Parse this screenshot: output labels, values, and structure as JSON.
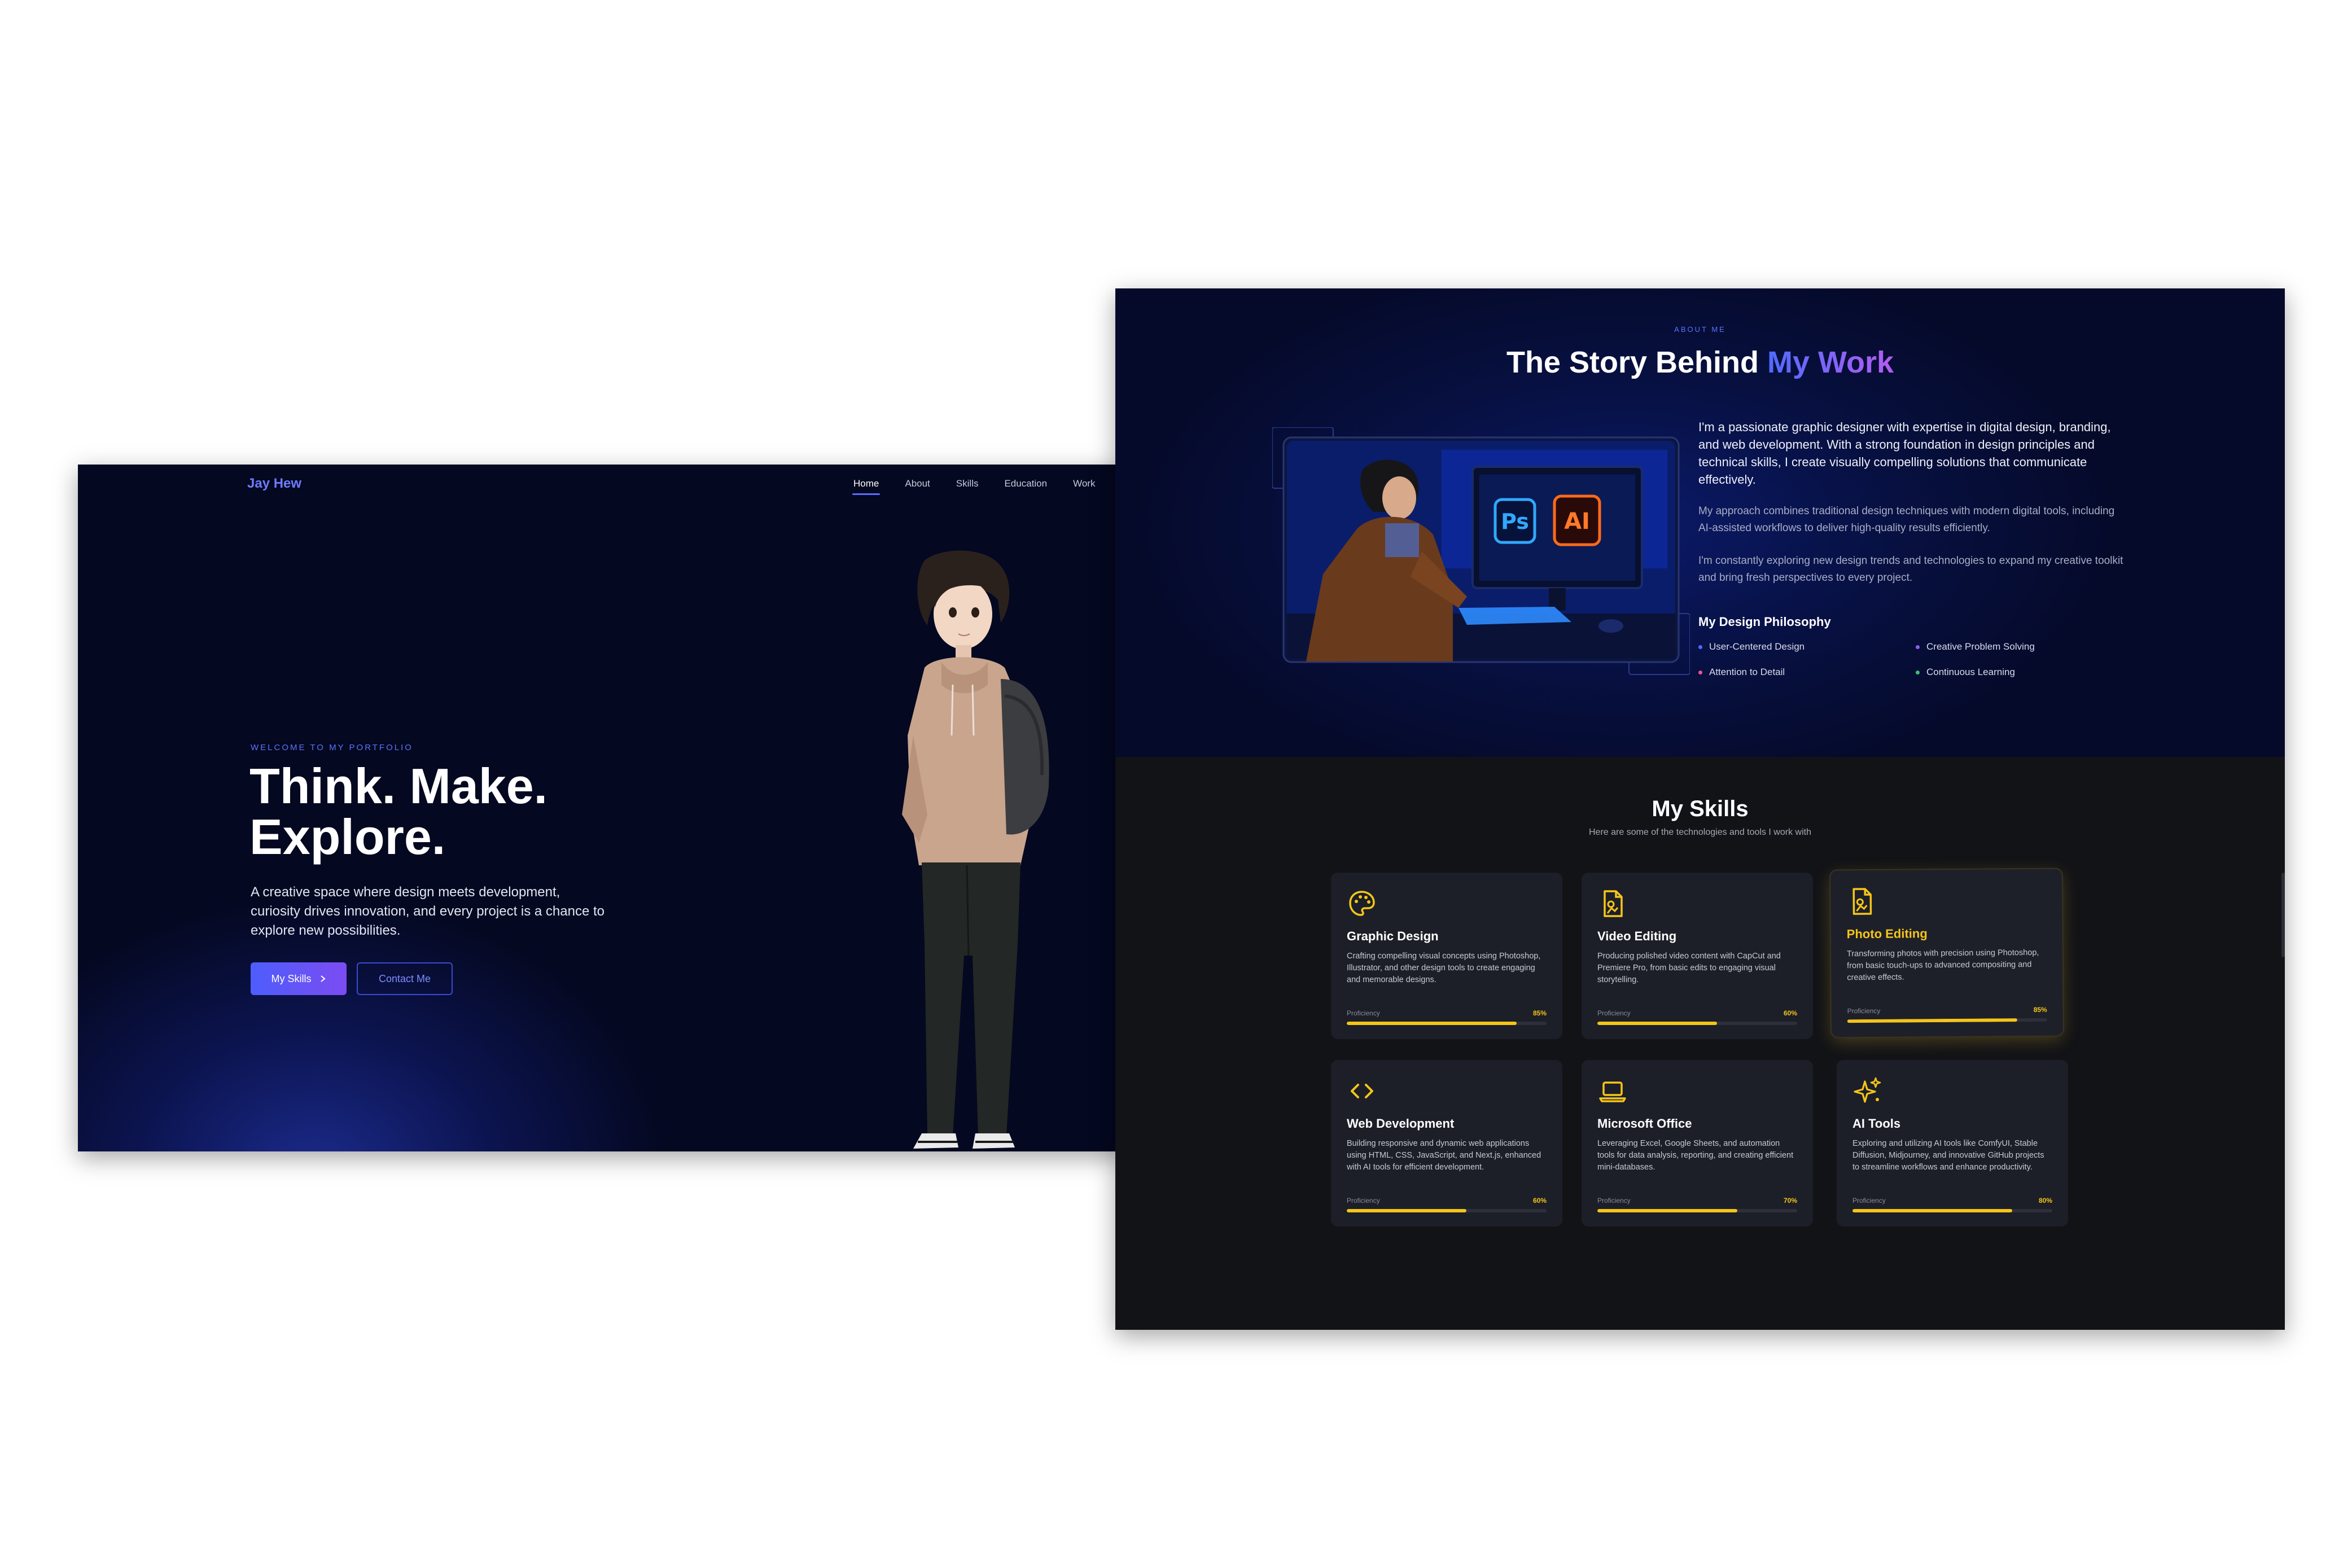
{
  "hero": {
    "logo": "Jay Hew",
    "nav": [
      "Home",
      "About",
      "Skills",
      "Education",
      "Work"
    ],
    "eyebrow": "WELCOME TO MY PORTFOLIO",
    "title_line1": "Think. Make.",
    "title_line2": "Explore.",
    "description": "A creative space where design meets development, curiosity drives innovation, and every project is a chance to explore new possibilities.",
    "primary_button": "My Skills",
    "primary_button_icon": "chevron-right-icon",
    "secondary_button": "Contact Me"
  },
  "about": {
    "eyebrow": "ABOUT ME",
    "title_plain": "The Story Behind ",
    "title_highlight": "My Work",
    "p1": "I'm a passionate graphic designer with expertise in digital design, branding, and web development. With a strong foundation in design principles and technical skills, I create visually compelling solutions that communicate effectively.",
    "p2": "My approach combines traditional design techniques with modern digital tools, including AI-assisted workflows to deliver high-quality results efficiently.",
    "p3": "I'm constantly exploring new design trends and technologies to expand my creative toolkit and bring fresh perspectives to every project.",
    "philosophy_title": "My Design Philosophy",
    "philosophy": [
      {
        "label": "User-Centered Design",
        "color": "#4f6bff"
      },
      {
        "label": "Creative Problem Solving",
        "color": "#8f5cf0"
      },
      {
        "label": "Attention to Detail",
        "color": "#e8558a"
      },
      {
        "label": "Continuous Learning",
        "color": "#39c07a"
      }
    ],
    "illustration_labels": [
      "Ps",
      "AI"
    ]
  },
  "skills": {
    "title": "My Skills",
    "subtitle": "Here are some of the technologies and tools I work with",
    "proficiency_label": "Proficiency",
    "accent": "#f5c518",
    "cards": [
      {
        "icon": "palette-icon",
        "title": "Graphic Design",
        "desc": "Crafting compelling visual concepts using Photoshop, Illustrator, and other design tools to create engaging and memorable designs.",
        "value": "85%",
        "pct": 85
      },
      {
        "icon": "video-file-icon",
        "title": "Video Editing",
        "desc": "Producing polished video content with CapCut and Premiere Pro, from basic edits to engaging visual storytelling.",
        "value": "60%",
        "pct": 60
      },
      {
        "icon": "image-file-icon",
        "title": "Photo Editing",
        "desc": "Transforming photos with precision using Photoshop, from basic touch-ups to advanced compositing and creative effects.",
        "value": "85%",
        "pct": 85
      },
      {
        "icon": "code-icon",
        "title": "Web Development",
        "desc": "Building responsive and dynamic web applications using HTML, CSS, JavaScript, and Next.js, enhanced with AI tools for efficient development.",
        "value": "60%",
        "pct": 60
      },
      {
        "icon": "laptop-icon",
        "title": "Microsoft Office",
        "desc": "Leveraging Excel, Google Sheets, and automation tools for data analysis, reporting, and creating efficient mini-databases.",
        "value": "70%",
        "pct": 70
      },
      {
        "icon": "sparkles-icon",
        "title": "AI Tools",
        "desc": "Exploring and utilizing AI tools like ComfyUI, Stable Diffusion, Midjourney, and innovative GitHub projects to streamline workflows and enhance productivity.",
        "value": "80%",
        "pct": 80
      }
    ]
  }
}
